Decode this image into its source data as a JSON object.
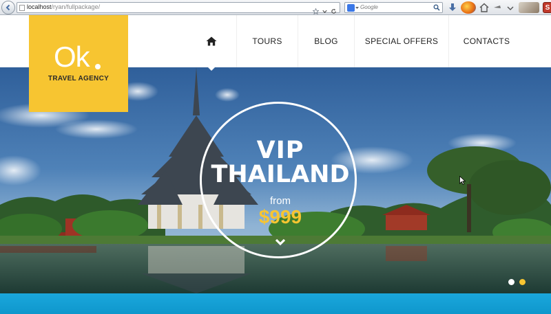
{
  "browser": {
    "url_host": "localhost",
    "url_path": "/ryan/fullpackage/",
    "search_placeholder": "Google"
  },
  "logo": {
    "mark": "Ok",
    "tagline": "TRAVEL AGENCY",
    "accent_color": "#f7c531"
  },
  "nav": {
    "home_icon": "home-icon",
    "items": [
      {
        "label": "TOURS"
      },
      {
        "label": "BLOG"
      },
      {
        "label": "SPECIAL OFFERS"
      },
      {
        "label": "CONTACTS"
      }
    ]
  },
  "hero": {
    "line1": "VIP",
    "line2": "THAILAND",
    "from_label": "from",
    "price": "$999",
    "price_color": "#f7c531",
    "scroll_icon": "chevron-down-icon",
    "slides": [
      {
        "active": false
      },
      {
        "active": true
      }
    ]
  },
  "footer_strip": {
    "color": "#1aa7dc"
  }
}
